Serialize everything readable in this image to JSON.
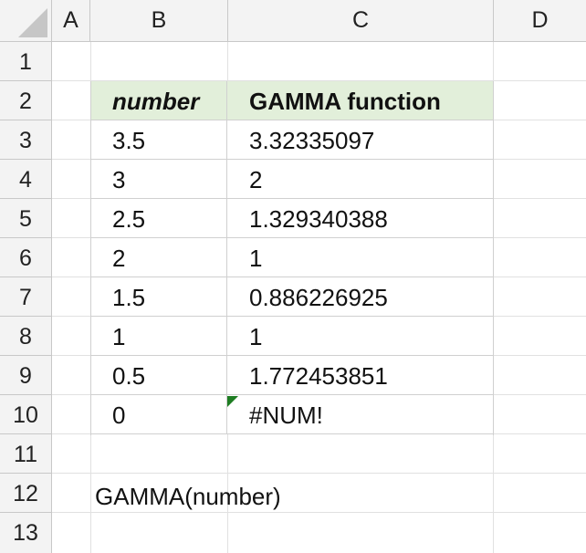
{
  "columns": [
    "A",
    "B",
    "C",
    "D"
  ],
  "rows": [
    "1",
    "2",
    "3",
    "4",
    "5",
    "6",
    "7",
    "8",
    "9",
    "10",
    "11",
    "12",
    "13"
  ],
  "table": {
    "header": {
      "number": "number",
      "result": "GAMMA function"
    },
    "rows": [
      {
        "number": "3.5",
        "result": "3.32335097"
      },
      {
        "number": "3",
        "result": "2"
      },
      {
        "number": "2.5",
        "result": "1.329340388"
      },
      {
        "number": "2",
        "result": "1"
      },
      {
        "number": "1.5",
        "result": "0.886226925"
      },
      {
        "number": "1",
        "result": "1"
      },
      {
        "number": "0.5",
        "result": "1.772453851"
      },
      {
        "number": "0",
        "result": "#NUM!"
      }
    ]
  },
  "syntax_note": "GAMMA(number)",
  "colors": {
    "header_fill": "#e2efda",
    "error_indicator": "#1e7d22"
  }
}
